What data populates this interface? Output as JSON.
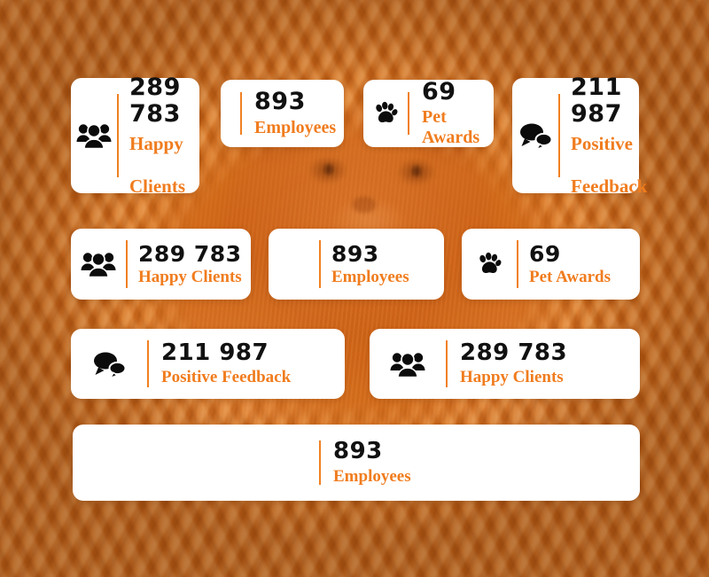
{
  "theme": {
    "accent": "#F07C1E",
    "divider": "#F08022",
    "number_color": "#111111",
    "card_background": "#FFFFFF",
    "page_background": "#E3821F"
  },
  "background": {
    "description": "orange-tinted photo of kittens in a wicker basket"
  },
  "cards": [
    {
      "id": "happy-clients-stacked",
      "icon": "people-group-icon",
      "number": "289 783",
      "number_lines": [
        "289",
        "783"
      ],
      "label": "Happy Clients",
      "label_lines": [
        "Happy",
        "Clients"
      ],
      "layout": "stacked"
    },
    {
      "id": "employees-compact",
      "icon": "none",
      "number": "893",
      "label": "Employees",
      "layout": "compact"
    },
    {
      "id": "pet-awards-compact",
      "icon": "paw-print-icon",
      "number": "69",
      "label": "Pet Awards",
      "layout": "compact-icon"
    },
    {
      "id": "positive-feedback-stacked",
      "icon": "speech-bubbles-icon",
      "number": "211 987",
      "number_lines": [
        "211",
        "987"
      ],
      "label": "Positive Feedback",
      "label_lines": [
        "Positive",
        "Feedback"
      ],
      "layout": "stacked"
    },
    {
      "id": "happy-clients-row",
      "icon": "people-group-icon",
      "number": "289 783",
      "label": "Happy Clients",
      "layout": "row"
    },
    {
      "id": "employees-row",
      "icon": "none",
      "number": "893",
      "label": "Employees",
      "layout": "row-noicon"
    },
    {
      "id": "pet-awards-row",
      "icon": "paw-print-icon",
      "number": "69",
      "label": "Pet Awards",
      "layout": "row"
    },
    {
      "id": "positive-feedback-wide",
      "icon": "speech-bubbles-icon",
      "number": "211 987",
      "label": "Positive Feedback",
      "layout": "wide"
    },
    {
      "id": "happy-clients-wide",
      "icon": "people-group-icon",
      "number": "289 783",
      "label": "Happy Clients",
      "layout": "wide"
    },
    {
      "id": "employees-banner",
      "icon": "none",
      "number": "893",
      "label": "Employees",
      "layout": "banner"
    }
  ]
}
